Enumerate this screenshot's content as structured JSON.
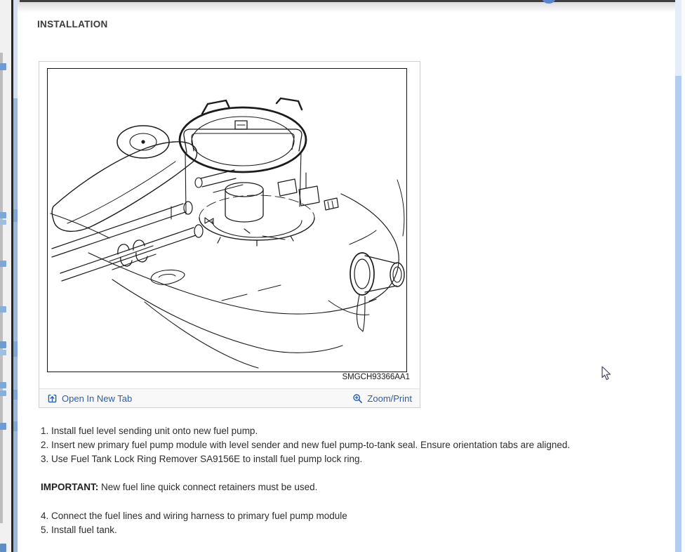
{
  "header": {
    "title": "INSTALLATION"
  },
  "figure": {
    "image_code": "SMGCH93366AA1",
    "open_in_new_tab_label": "Open In New Tab",
    "zoom_print_label": "Zoom/Print",
    "diagram_description": "Line drawing of fuel tank with fuel pump module, lock ring and filler neck"
  },
  "instructions": {
    "items_before_note": [
      "1. Install fuel level sending unit onto new fuel pump.",
      "2. Insert new primary fuel pump module with level sender and new fuel pump-to-tank seal. Ensure orientation tabs are aligned.",
      "3. Use Fuel Tank Lock Ring Remover SA9156E to install fuel pump lock ring."
    ],
    "note_label": "IMPORTANT:",
    "note_text": "New fuel line quick connect retainers must be used.",
    "items_after_note": [
      "4. Connect the fuel lines and wiring harness to primary fuel pump module",
      "5. Install fuel tank."
    ]
  },
  "colors": {
    "link_blue": "#2a5da8",
    "top_bar": "#3f3f3f",
    "left_scrollbar_blue": "#9db9d9",
    "right_scrollbar_thumb": "#b2cdee"
  },
  "icons": {
    "open_in_new_tab": "open-in-new-tab-icon",
    "zoom_print": "magnifier-plus-icon",
    "cursor": "arrow-cursor-icon"
  }
}
